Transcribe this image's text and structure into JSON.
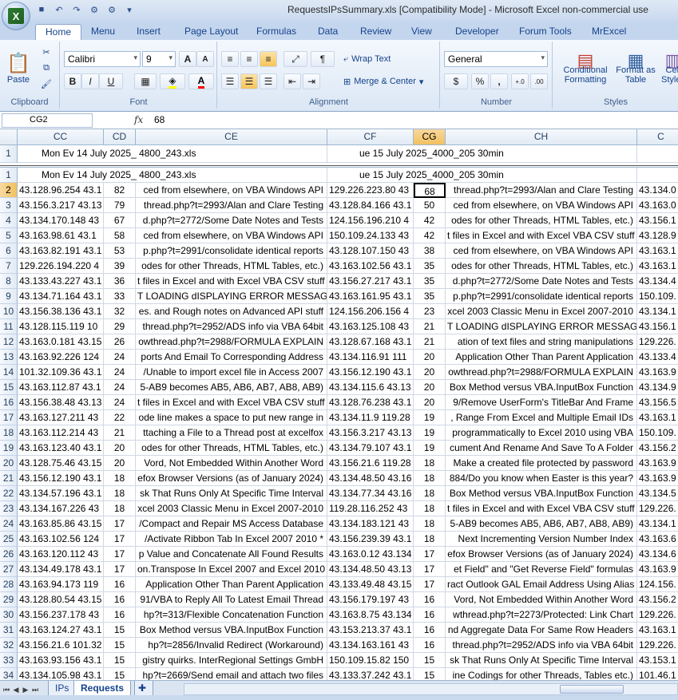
{
  "window": {
    "title": "RequestsIPsSummary.xls  [Compatibility Mode] - Microsoft Excel non-commercial use",
    "office_button_letter": "X"
  },
  "qat": {
    "save_icon": "save-icon",
    "undo_icon": "undo-icon",
    "redo_icon": "redo-icon"
  },
  "tabs": [
    "Home",
    "Menu",
    "Insert",
    "Page Layout",
    "Formulas",
    "Data",
    "Review",
    "View",
    "Developer",
    "Forum Tools",
    "MrExcel"
  ],
  "ribbon": {
    "clipboard": {
      "label": "Clipboard",
      "paste": "Paste"
    },
    "font": {
      "label": "Font",
      "name": "Calibri",
      "size": "9",
      "bold": "B",
      "italic": "I",
      "underline": "U",
      "grow": "A",
      "shrink": "A"
    },
    "alignment": {
      "label": "Alignment",
      "wrap": "Wrap Text",
      "merge": "Merge & Center"
    },
    "number": {
      "label": "Number",
      "format": "General",
      "currency": "$",
      "percent": "%",
      "comma": ",",
      "inc": "+.0",
      "dec": ".00"
    },
    "styles": {
      "label": "Styles",
      "conditional": "Conditional Formatting",
      "format_table": "Format as Table",
      "cell_styles": "Cell Styles"
    }
  },
  "formula_bar": {
    "name_box": "CG2",
    "fx": "fx",
    "value": "68"
  },
  "columns": [
    "CC",
    "CD",
    "CE",
    "CF",
    "CG",
    "CH"
  ],
  "frozen_row": {
    "num": "1",
    "cc": "Mon Ev 14 July 2025_ 4800_243.xls",
    "cf": "ue 15 July 2025_4000_205 30min"
  },
  "header_row": {
    "num": "1",
    "cc": "Mon Ev 14 July 2025_ 4800_243.xls",
    "cf": "ue 15 July 2025_4000_205 30min"
  },
  "rows": [
    {
      "n": "2",
      "cc": "43.128.96.254 43.1",
      "cd": "82",
      "ce": "ced from elsewhere, on VBA Windows API",
      "cf": "129.226.223.80 43",
      "cg": "68",
      "ch": "thread.php?t=2993/Alan and Clare Testing",
      "ci": "43.134.0"
    },
    {
      "n": "3",
      "cc": "43.156.3.217 43.13",
      "cd": "79",
      "ce": "thread.php?t=2993/Alan and Clare Testing",
      "cf": "43.128.84.166 43.1",
      "cg": "50",
      "ch": "ced from elsewhere, on VBA Windows API",
      "ci": "43.163.0"
    },
    {
      "n": "4",
      "cc": "43.134.170.148 43",
      "cd": "67",
      "ce": "d.php?t=2772/Some Date Notes and Tests",
      "cf": "124.156.196.210 4",
      "cg": "42",
      "ch": "odes for other Threads, HTML Tables, etc.)",
      "ci": "43.156.1"
    },
    {
      "n": "5",
      "cc": "43.163.98.61 43.1",
      "cd": "58",
      "ce": "ced from elsewhere, on VBA Windows API",
      "cf": "150.109.24.133 43",
      "cg": "42",
      "ch": "t files in Excel and with Excel VBA CSV stuff",
      "ci": "43.128.9"
    },
    {
      "n": "6",
      "cc": "43.163.82.191 43.1",
      "cd": "53",
      "ce": "p.php?t=2991/consolidate identical reports",
      "cf": "43.128.107.150 43",
      "cg": "38",
      "ch": "ced from elsewhere, on VBA Windows API",
      "ci": "43.163.1"
    },
    {
      "n": "7",
      "cc": "129.226.194.220 4",
      "cd": "39",
      "ce": "odes for other Threads, HTML Tables, etc.)",
      "cf": "43.163.102.56 43.1",
      "cg": "35",
      "ch": "odes for other Threads, HTML Tables, etc.)",
      "ci": "43.163.1"
    },
    {
      "n": "8",
      "cc": "43.133.43.227 43.1",
      "cd": "36",
      "ce": "t files in Excel and with Excel VBA CSV stuff",
      "cf": "43.156.27.217 43.1",
      "cg": "35",
      "ch": "d.php?t=2772/Some Date Notes and Tests",
      "ci": "43.134.4"
    },
    {
      "n": "9",
      "cc": "43.134.71.164 43.1",
      "cd": "33",
      "ce": "T LOADING dISPLAYING ERROR MESSAGE",
      "cf": "43.163.161.95 43.1",
      "cg": "35",
      "ch": "p.php?t=2991/consolidate identical reports",
      "ci": "150.109."
    },
    {
      "n": "10",
      "cc": "43.156.38.136 43.1",
      "cd": "32",
      "ce": "es. and Rough notes on Advanced API stuff",
      "cf": "124.156.206.156 4",
      "cg": "23",
      "ch": "xcel 2003 Classic Menu in Excel 2007-2010",
      "ci": "43.134.1"
    },
    {
      "n": "11",
      "cc": "43.128.115.119 10",
      "cd": "29",
      "ce": "thread.php?t=2952/ADS info via VBA 64bit",
      "cf": "43.163.125.108 43",
      "cg": "21",
      "ch": "T LOADING dISPLAYING ERROR MESSAGE",
      "ci": "43.156.1"
    },
    {
      "n": "12",
      "cc": "43.163.0.181 43.15",
      "cd": "26",
      "ce": "owthread.php?t=2988/FORMULA EXPLAIN",
      "cf": "43.128.67.168 43.1",
      "cg": "21",
      "ch": "ation of text files and string manipulations",
      "ci": "129.226."
    },
    {
      "n": "13",
      "cc": "43.163.92.226 124",
      "cd": "24",
      "ce": "ports And Email To Corresponding Address",
      "cf": "43.134.116.91 111",
      "cg": "20",
      "ch": "Application Other Than Parent Application",
      "ci": "43.133.4"
    },
    {
      "n": "14",
      "cc": "101.32.109.36 43.1",
      "cd": "24",
      "ce": "/Unable to import excel file in Access 2007",
      "cf": "43.156.12.190 43.1",
      "cg": "20",
      "ch": "owthread.php?t=2988/FORMULA EXPLAIN",
      "ci": "43.163.9"
    },
    {
      "n": "15",
      "cc": "43.163.112.87 43.1",
      "cd": "24",
      "ce": "5-AB9 becomes AB5, AB6, AB7, AB8, AB9)",
      "cf": "43.134.115.6 43.13",
      "cg": "20",
      "ch": "Box Method versus VBA.InputBox Function",
      "ci": "43.134.9"
    },
    {
      "n": "16",
      "cc": "43.156.38.48 43.13",
      "cd": "24",
      "ce": "t files in Excel and with Excel VBA CSV stuff",
      "cf": "43.128.76.238 43.1",
      "cg": "20",
      "ch": "9/Remove UserForm's TitleBar And Frame",
      "ci": "43.156.5"
    },
    {
      "n": "17",
      "cc": "43.163.127.211 43",
      "cd": "22",
      "ce": "ode line makes a space to put new range in",
      "cf": "43.134.11.9 119.28",
      "cg": "19",
      "ch": ", Range From Excel and Multiple Email IDs",
      "ci": "43.163.1"
    },
    {
      "n": "18",
      "cc": "43.163.112.214 43",
      "cd": "21",
      "ce": "ttaching a File to a Thread post at excelfox",
      "cf": "43.156.3.217 43.13",
      "cg": "19",
      "ch": "programmatically to Excel 2010 using VBA",
      "ci": "150.109."
    },
    {
      "n": "19",
      "cc": "43.163.123.40 43.1",
      "cd": "20",
      "ce": "odes for other Threads, HTML Tables, etc.)",
      "cf": "43.134.79.107 43.1",
      "cg": "19",
      "ch": "cument And Rename And Save To A Folder",
      "ci": "43.156.2"
    },
    {
      "n": "20",
      "cc": "43.128.75.46 43.15",
      "cd": "20",
      "ce": "Vord, Not Embedded Within Another Word",
      "cf": "43.156.21.6 119.28",
      "cg": "18",
      "ch": "Make a created file protected by password",
      "ci": "43.163.9"
    },
    {
      "n": "21",
      "cc": "43.156.12.190 43.1",
      "cd": "18",
      "ce": "efox Browser Versions (as of January 2024)",
      "cf": "43.134.48.50 43.16",
      "cg": "18",
      "ch": "884/Do you know when Easter is this year?",
      "ci": "43.163.9"
    },
    {
      "n": "22",
      "cc": "43.134.57.196 43.1",
      "cd": "18",
      "ce": "sk That Runs Only At Specific Time Interval",
      "cf": "43.134.77.34 43.16",
      "cg": "18",
      "ch": "Box Method versus VBA.InputBox Function",
      "ci": "43.134.5"
    },
    {
      "n": "23",
      "cc": "43.134.167.226 43",
      "cd": "18",
      "ce": "xcel 2003 Classic Menu in Excel 2007-2010",
      "cf": "119.28.116.252 43",
      "cg": "18",
      "ch": "t files in Excel and with Excel VBA CSV stuff",
      "ci": "129.226."
    },
    {
      "n": "24",
      "cc": "43.163.85.86 43.15",
      "cd": "17",
      "ce": "/Compact and Repair MS Access Database",
      "cf": "43.134.183.121 43",
      "cg": "18",
      "ch": "5-AB9 becomes AB5, AB6, AB7, AB8, AB9)",
      "ci": "43.134.1"
    },
    {
      "n": "25",
      "cc": "43.163.102.56 124",
      "cd": "17",
      "ce": "/Activate Ribbon Tab In Excel 2007 2010 *",
      "cf": "43.156.239.39 43.1",
      "cg": "18",
      "ch": "Next Incrementing Version Number Index",
      "ci": "43.163.6"
    },
    {
      "n": "26",
      "cc": "43.163.120.112 43",
      "cd": "17",
      "ce": "p Value and Concatenate All Found Results",
      "cf": "43.163.0.12 43.134",
      "cg": "17",
      "ch": "efox Browser Versions (as of January 2024)",
      "ci": "43.134.6"
    },
    {
      "n": "27",
      "cc": "43.134.49.178 43.1",
      "cd": "17",
      "ce": "on.Transpose In Excel 2007 and Excel 2010",
      "cf": "43.134.48.50 43.13",
      "cg": "17",
      "ch": "et Field\" and \"Get Reverse Field\" formulas",
      "ci": "43.163.9"
    },
    {
      "n": "28",
      "cc": "43.163.94.173 119",
      "cd": "16",
      "ce": "Application Other Than Parent Application",
      "cf": "43.133.49.48 43.15",
      "cg": "17",
      "ch": "ract Outlook GAL Email Address Using Alias",
      "ci": "124.156."
    },
    {
      "n": "29",
      "cc": "43.128.80.54 43.15",
      "cd": "16",
      "ce": "91/VBA to Reply All To Latest Email Thread",
      "cf": "43.156.179.197 43",
      "cg": "16",
      "ch": "Vord, Not Embedded Within Another Word",
      "ci": "43.156.2"
    },
    {
      "n": "30",
      "cc": "43.156.237.178 43",
      "cd": "16",
      "ce": "hp?t=313/Flexible Concatenation Function",
      "cf": "43.163.8.75 43.134",
      "cg": "16",
      "ch": "wthread.php?t=2273/Protected: Link Chart",
      "ci": "129.226."
    },
    {
      "n": "31",
      "cc": "43.163.124.27 43.1",
      "cd": "15",
      "ce": "Box Method versus VBA.InputBox Function",
      "cf": "43.153.213.37 43.1",
      "cg": "16",
      "ch": "nd Aggregate Data For Same Row Headers",
      "ci": "43.163.1"
    },
    {
      "n": "32",
      "cc": "43.156.21.6 101.32",
      "cd": "15",
      "ce": "hp?t=2856/Invalid Redirect (Workaround)",
      "cf": "43.134.163.161 43",
      "cg": "16",
      "ch": "thread.php?t=2952/ADS info via VBA 64bit",
      "ci": "129.226."
    },
    {
      "n": "33",
      "cc": "43.163.93.156 43.1",
      "cd": "15",
      "ce": "gistry quirks. InterRegional Settings GmbH",
      "cf": "150.109.15.82 150",
      "cg": "15",
      "ch": "sk That Runs Only At Specific Time Interval",
      "ci": "43.153.1"
    },
    {
      "n": "34",
      "cc": "43.134.105.98 43.1",
      "cd": "15",
      "ce": "hp?t=2669/Send email and attach two files",
      "cf": "43.133.37.242 43.1",
      "cg": "15",
      "ch": "ine Codings for other Threads, Tables etc.)",
      "ci": "101.46.1"
    }
  ],
  "sheet_tabs": [
    "IPs",
    "Requests"
  ]
}
